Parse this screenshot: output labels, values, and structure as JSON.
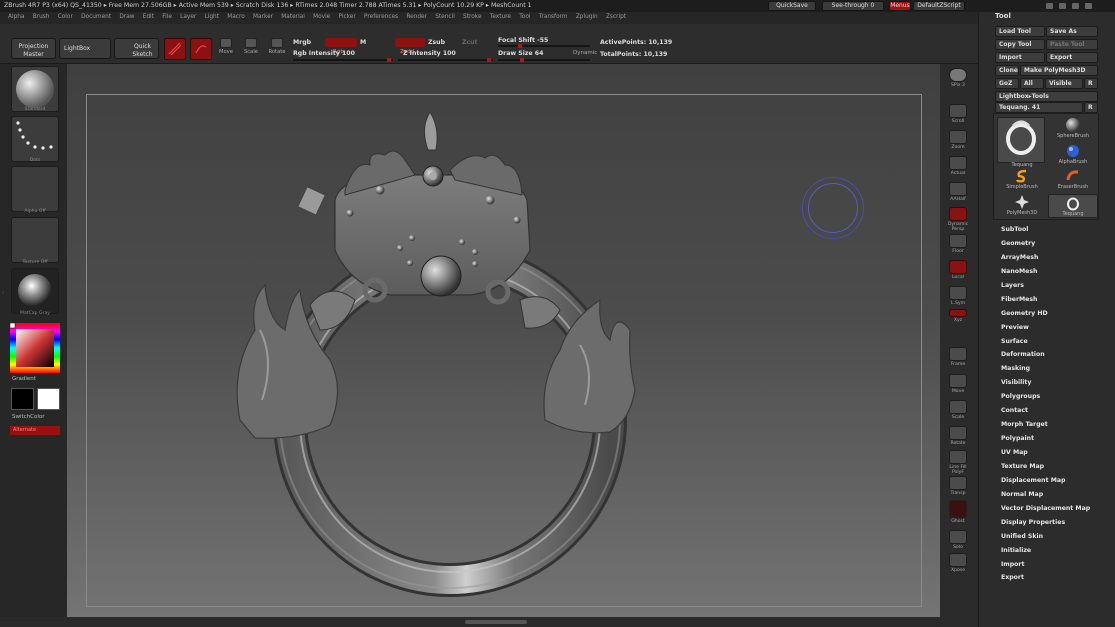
{
  "title_bar": {
    "app_info": "ZBrush 4R7 P3 (x64)   QS_41350   ▸ Free Mem 27.506GB ▸ Active Mem 539 ▸ Scratch Disk 136 ▸ RTimes 2.048 Timer 2.788 ATimes 5.31 ▸ PolyCount 10.29 KP ▸ MeshCount 1",
    "quicksave": "QuickSave",
    "see_through": "See-through  0",
    "menus_label": "Menus",
    "default_script": "DefaultZScript"
  },
  "menu": {
    "items": [
      "Alpha",
      "Brush",
      "Color",
      "Document",
      "Draw",
      "Edit",
      "File",
      "Layer",
      "Light",
      "Macro",
      "Marker",
      "Material",
      "Movie",
      "Picker",
      "Preferences",
      "Render",
      "Stencil",
      "Stroke",
      "Texture",
      "Tool",
      "Transform",
      "Zplugin",
      "Zscript"
    ]
  },
  "toolbar": {
    "projection_master": "Projection Master",
    "lightbox": "LightBox",
    "quick_sketch": "Quick Sketch",
    "edit": "Edit",
    "draw": "Draw",
    "move": "Move",
    "scale": "Scale",
    "rotate": "Rotate",
    "mrgb": "Mrgb",
    "rgb": "Rgb",
    "m": "M",
    "rgb_intensity": "Rgb Intensity 100",
    "zadd": "Zadd",
    "zsub": "Zsub",
    "zcut": "Zcut",
    "z_intensity": "Z Intensity 100",
    "focal_shift": "Focal Shift -55",
    "draw_size": "Draw Size 64",
    "dynamic": "Dynamic",
    "active_points": "ActivePoints: 10,139",
    "total_points": "TotalPoints: 10,139"
  },
  "left_shelf": {
    "brush_label": "Standard",
    "stroke_label": "Dots",
    "alpha_label": "Alpha Off",
    "texture_label": "Texture Off",
    "material_label": "MatCap Gray",
    "gradient": "Gradient",
    "switch_color": "SwitchColor",
    "alternate": "Alternate"
  },
  "right_shelf": {
    "buttons": [
      "SPix 3",
      "Scroll",
      "Zoom",
      "Actual",
      "AAHalf",
      "Dynamic Persp",
      "Floor",
      "Local",
      "L.Sym",
      "Xyz",
      "Frame",
      "Move",
      "Scale",
      "Rotate",
      "Line Fill PolyF",
      "Transp",
      "Ghost",
      "Solo",
      "Xpose"
    ]
  },
  "tool_panel": {
    "title": "Tool",
    "load_tool": "Load Tool",
    "save_as": "Save As",
    "copy_tool": "Copy Tool",
    "paste_tool": "Paste Tool",
    "import": "Import",
    "export": "Export",
    "clone": "Clone",
    "make_polymesh": "Make PolyMesh3D",
    "goz": "GoZ",
    "all": "All",
    "visible": "Visible",
    "r": "R",
    "lightbox_tools": "Lightbox▸Tools",
    "tool_name": "Tequang. 41",
    "tools": [
      {
        "name": "Tequang",
        "icon": "ring"
      },
      {
        "name": "SphereBrush",
        "icon": "sphere"
      },
      {
        "name": "AlphaBrush",
        "icon": "alpha"
      },
      {
        "name": "SimpleBrush",
        "icon": "simple"
      },
      {
        "name": "EraserBrush",
        "icon": "eraser"
      },
      {
        "name": "PolyMesh3D",
        "icon": "star"
      },
      {
        "name": "Tequang",
        "icon": "ring-small"
      }
    ],
    "subpalettes": [
      "SubTool",
      "Geometry",
      "ArrayMesh",
      "NanoMesh",
      "Layers",
      "FiberMesh",
      "Geometry HD",
      "Preview",
      "Surface",
      "Deformation",
      "Masking",
      "Visibility",
      "Polygroups",
      "Contact",
      "Morph Target",
      "Polypaint",
      "UV Map",
      "Texture Map",
      "Displacement Map",
      "Normal Map",
      "Vector Displacement Map",
      "Display Properties",
      "Unified Skin",
      "Initialize",
      "Import",
      "Export"
    ]
  }
}
